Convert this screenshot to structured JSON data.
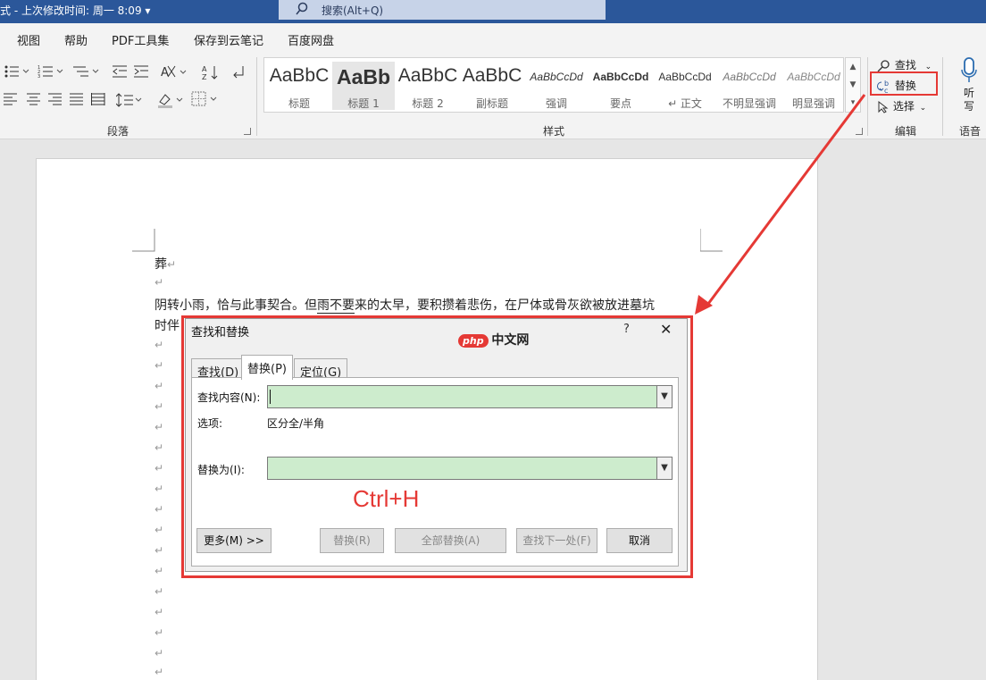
{
  "titlebar": {
    "doc_status": "式 - 上次修改时间: 周一 8:09 ▾",
    "search_placeholder": "搜索(Alt+Q)",
    "icon": "search-icon"
  },
  "ribbon_tabs": [
    "视图",
    "帮助",
    "PDF工具集",
    "保存到云笔记",
    "百度网盘"
  ],
  "ribbon": {
    "paragraph_group_label": "段落",
    "styles_group_label": "样式",
    "editing_group_label": "编辑",
    "voice_group_label": "语音",
    "styles": [
      {
        "sample": "AaBbC",
        "name": "标题"
      },
      {
        "sample": "AaBb",
        "name": "标题 1"
      },
      {
        "sample": "AaBbC",
        "name": "标题 2"
      },
      {
        "sample": "AaBbC",
        "name": "副标题"
      },
      {
        "sample": "AaBbCcDd",
        "name": "强调"
      },
      {
        "sample": "AaBbCcDd",
        "name": "要点"
      },
      {
        "sample": "AaBbCcDd",
        "name": "↵ 正文"
      },
      {
        "sample": "AaBbCcDd",
        "name": "不明显强调"
      },
      {
        "sample": "AaBbCcDd",
        "name": "明显强调"
      }
    ],
    "editing": {
      "find_label": "查找",
      "replace_label": "替换",
      "select_label": "选择"
    },
    "voice": {
      "dictate_label": "听写"
    }
  },
  "document": {
    "line1": "葬",
    "line2a": "阴转小雨，恰与此事契合。但",
    "line2u": "雨不要",
    "line2b": "来的太早，要积攒着悲伤，在尸体或骨灰欲被放进墓坑",
    "line3": "时伴",
    "para_mark": "↵"
  },
  "dialog": {
    "title": "查找和替换",
    "help": "?",
    "close": "✕",
    "watermark_badge": "php",
    "watermark_text": "中文网",
    "tabs": [
      "查找(D)",
      "替换(P)",
      "定位(G)"
    ],
    "active_tab": "替换(P)",
    "find_label": "查找内容(N):",
    "find_value": "",
    "options_label": "选项:",
    "options_value": "区分全/半角",
    "replace_label": "替换为(I):",
    "replace_value": "",
    "shortcut_hint": "Ctrl+H",
    "buttons": {
      "more": "更多(M) >>",
      "replace": "替换(R)",
      "replace_all": "全部替换(A)",
      "find_next": "查找下一处(F)",
      "cancel": "取消"
    }
  },
  "colors": {
    "titlebar": "#2b579a",
    "highlight_red": "#e53935",
    "field_green": "#cdeccd"
  }
}
